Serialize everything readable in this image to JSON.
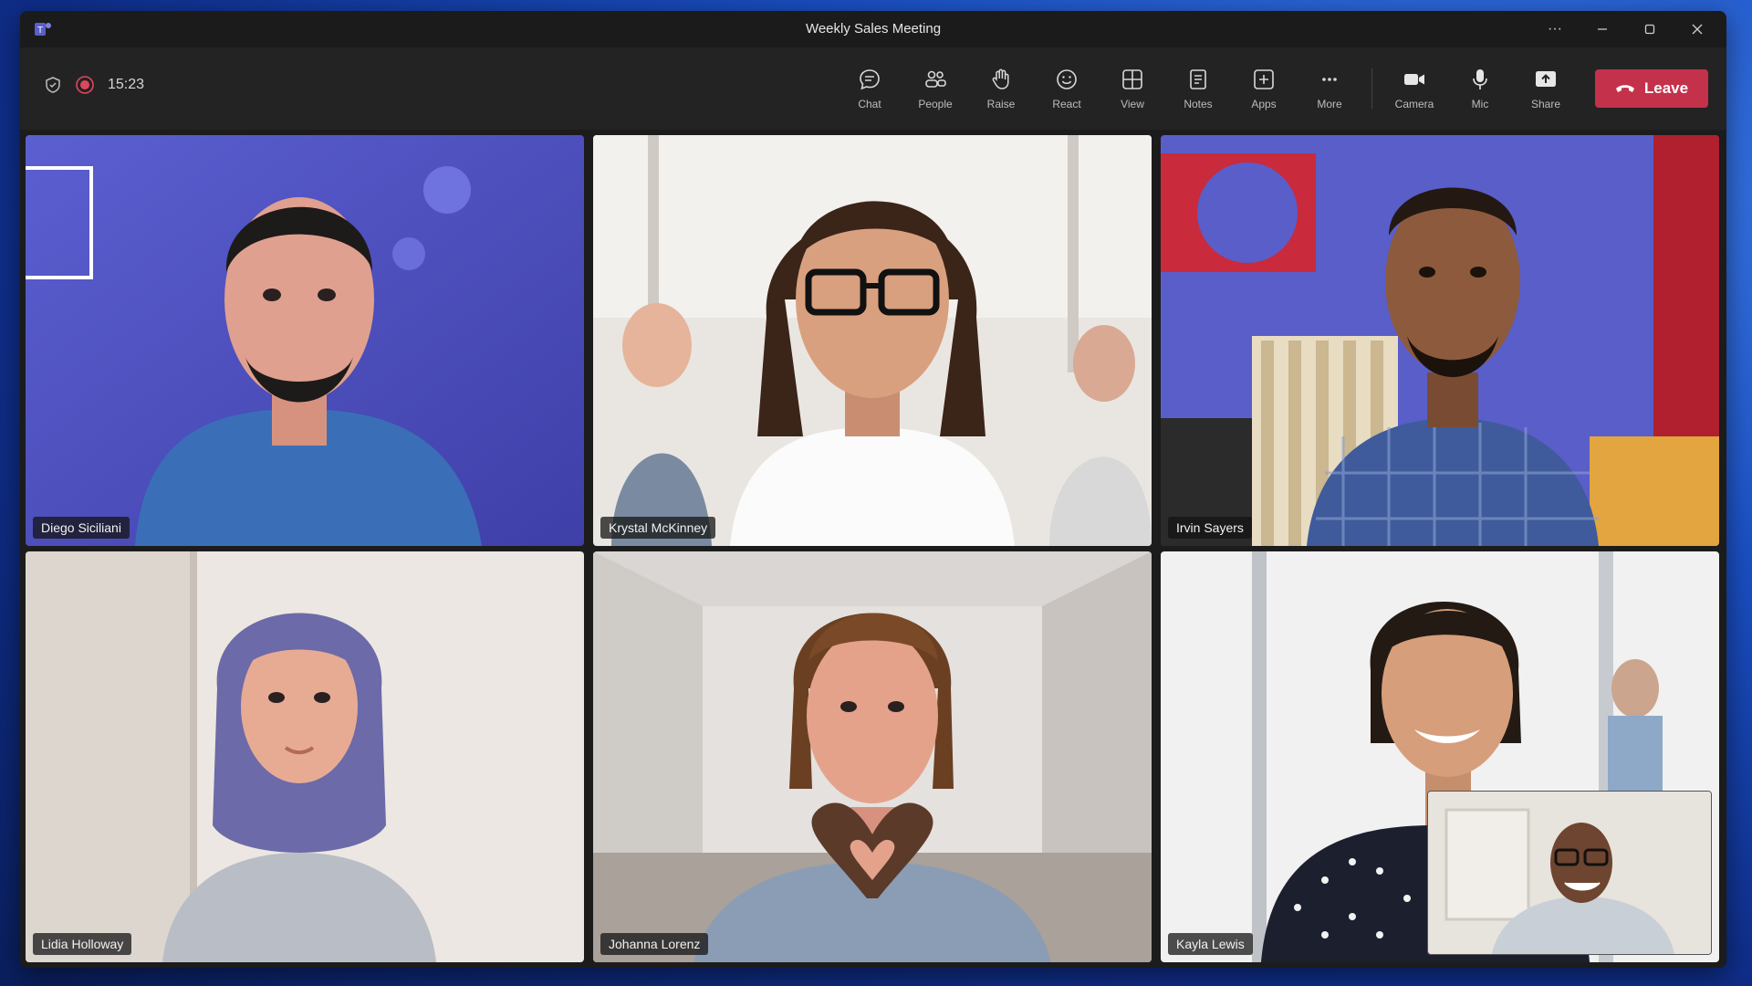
{
  "window": {
    "title": "Weekly Sales Meeting"
  },
  "toolbar": {
    "timer": "15:23",
    "buttons": [
      {
        "label": "Chat",
        "icon": "chat-icon"
      },
      {
        "label": "People",
        "icon": "people-icon"
      },
      {
        "label": "Raise",
        "icon": "hand-icon"
      },
      {
        "label": "React",
        "icon": "smile-icon"
      },
      {
        "label": "View",
        "icon": "grid-icon"
      },
      {
        "label": "Notes",
        "icon": "notes-icon"
      },
      {
        "label": "Apps",
        "icon": "plus-square-icon"
      },
      {
        "label": "More",
        "icon": "ellipsis-icon"
      },
      {
        "label": "Camera",
        "icon": "camera-icon"
      },
      {
        "label": "Mic",
        "icon": "mic-icon"
      },
      {
        "label": "Share",
        "icon": "share-icon"
      }
    ],
    "leave_label": "Leave"
  },
  "participants": [
    {
      "name": "Diego Siciliani"
    },
    {
      "name": "Krystal McKinney"
    },
    {
      "name": "Irvin Sayers"
    },
    {
      "name": "Lidia Holloway"
    },
    {
      "name": "Johanna Lorenz"
    },
    {
      "name": "Kayla Lewis"
    }
  ],
  "colors": {
    "accent": "#7b83eb",
    "leave": "#c4314b"
  }
}
